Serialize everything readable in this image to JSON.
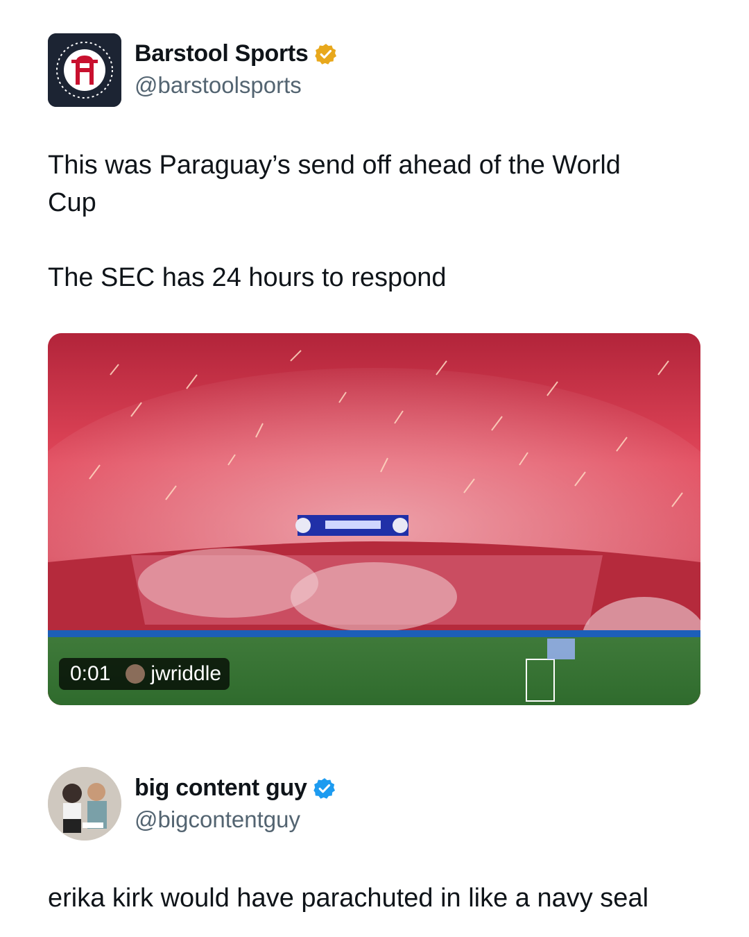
{
  "post1": {
    "display_name": "Barstool Sports",
    "handle": "@barstoolsports",
    "verified_badge": "gold-verified-icon",
    "text_line1": "This was Paraguay’s send off ahead of the World",
    "text_line2": "Cup",
    "text_line3": "The SEC has 24 hours to respond",
    "video": {
      "timestamp": "0:01",
      "credit": "jwriddle"
    }
  },
  "post2": {
    "display_name": "big content guy",
    "handle": "@bigcontentguy",
    "verified_badge": "blue-verified-icon",
    "text": "erika kirk would have parachuted in like a navy seal"
  },
  "colors": {
    "gold_badge": "#e8a81c",
    "blue_badge": "#1d9bf0",
    "handle_gray": "#536471"
  }
}
